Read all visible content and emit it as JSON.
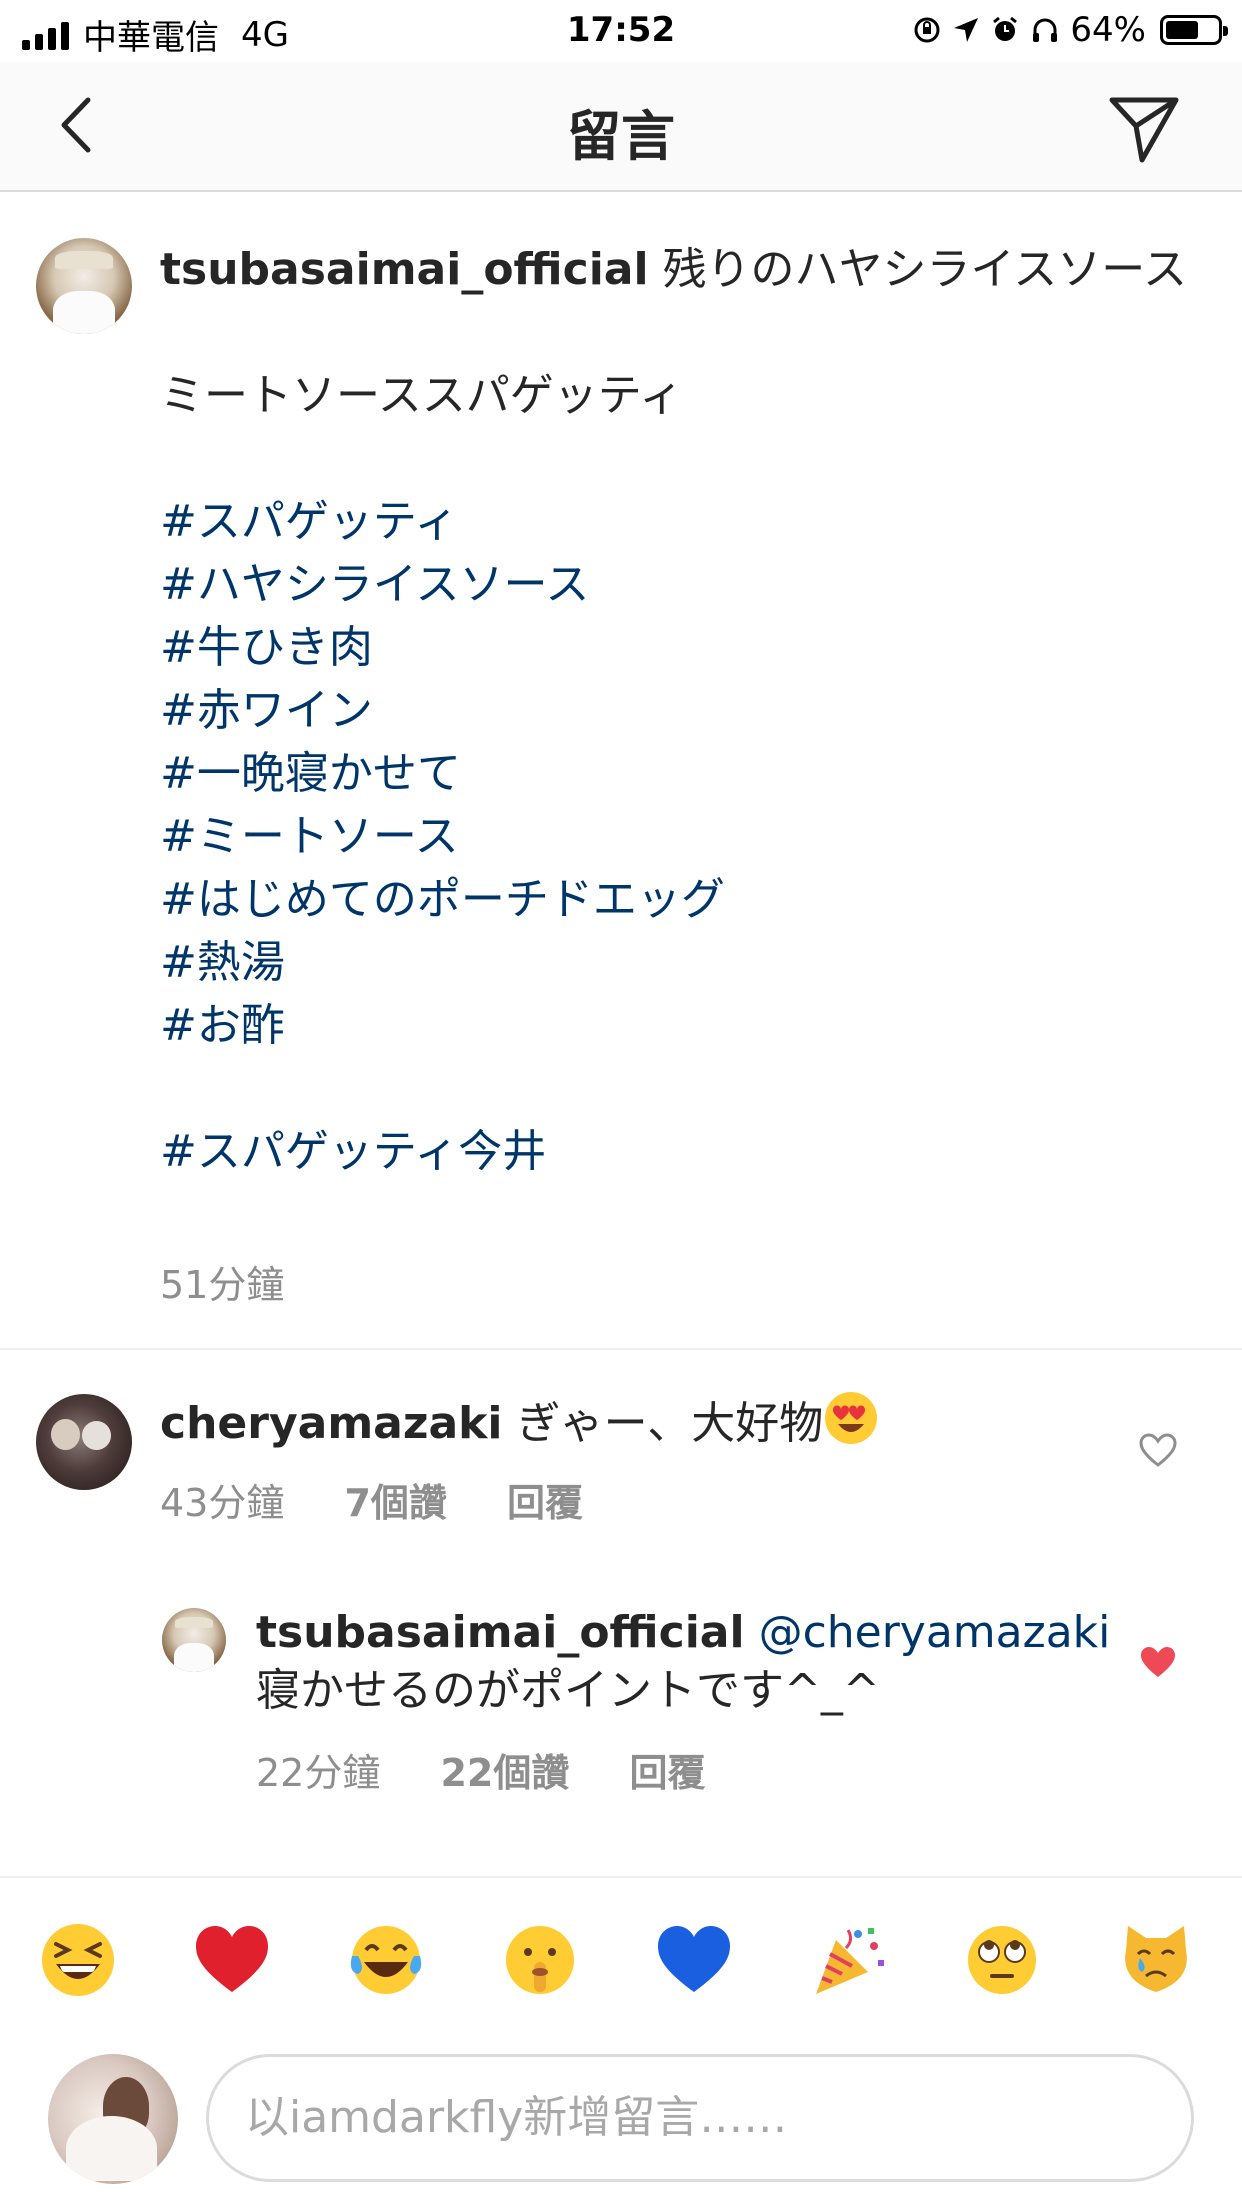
{
  "status_bar": {
    "carrier": "中華電信",
    "network": "4G",
    "time": "17:52",
    "battery": "64%",
    "battery_level": 0.64
  },
  "nav": {
    "title": "留言"
  },
  "post": {
    "username": "tsubasaimai_official",
    "caption_line1": "残りのハヤシライスソース",
    "caption_line2": "ミートソーススパゲッティ",
    "hashtags": [
      "#スパゲッティ",
      "#ハヤシライスソース",
      "#牛ひき肉",
      "#赤ワイン",
      "#一晩寝かせて",
      "#ミートソース",
      "#はじめてのポーチドエッグ",
      "#熱湯",
      "#お酢"
    ],
    "final_tag": "#スパゲッティ今井",
    "time": "51分鐘"
  },
  "comments": [
    {
      "username": "cheryamazaki",
      "text": "ぎゃー、大好物",
      "emoji": "heart-eyes-emoji",
      "time": "43分鐘",
      "likes": "7個讚",
      "reply": "回覆",
      "liked": false
    },
    {
      "username": "tsubasaimai_official",
      "mention": "@cheryamazaki",
      "text": "寝かせるのがポイントです^_^",
      "time": "22分鐘",
      "likes": "22個讚",
      "reply": "回覆",
      "liked": true
    }
  ],
  "emoji_bar": [
    "grinning-squinting-face",
    "red-heart",
    "tears-of-joy",
    "shushing-face",
    "blue-heart",
    "party-popper",
    "eye-roll-face",
    "crying-cat-face"
  ],
  "composer": {
    "placeholder": "以iamdarkfly新增留言……"
  },
  "colors": {
    "text": "#262626",
    "hashtag": "#003569",
    "secondary": "#8e8e8e",
    "like_red": "#ed4956"
  }
}
